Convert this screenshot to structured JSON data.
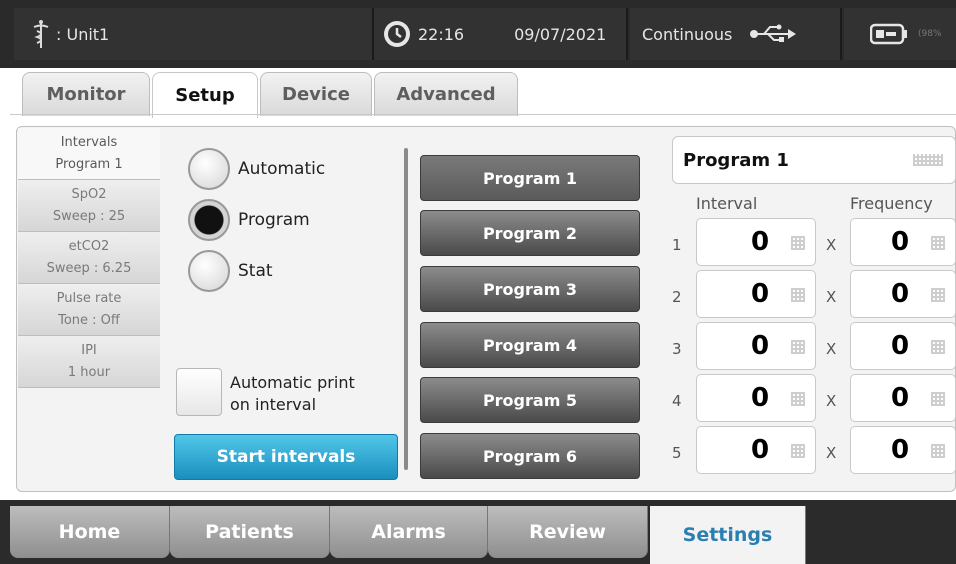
{
  "status_bar": {
    "unit": ": Unit1",
    "time": "22:16",
    "date": "09/07/2021",
    "mode": "Continuous",
    "battery_percent": "(98%"
  },
  "tabs": [
    {
      "label": "Monitor",
      "active": false
    },
    {
      "label": "Setup",
      "active": true
    },
    {
      "label": "Device",
      "active": false
    },
    {
      "label": "Advanced",
      "active": false
    }
  ],
  "side_list": [
    {
      "line1": "Intervals",
      "line2": "Program 1",
      "selected": true
    },
    {
      "line1": "SpO2",
      "line2": "Sweep : 25",
      "selected": false
    },
    {
      "line1": "etCO2",
      "line2": "Sweep : 6.25",
      "selected": false
    },
    {
      "line1": "Pulse rate",
      "line2": "Tone : Off",
      "selected": false
    },
    {
      "line1": "IPI",
      "line2": "1 hour",
      "selected": false
    }
  ],
  "interval_modes": {
    "options": [
      "Automatic",
      "Program",
      "Stat"
    ],
    "selected": "Program"
  },
  "auto_print": {
    "label_line1": "Automatic print",
    "label_line2": "on interval",
    "checked": false
  },
  "start_button": "Start intervals",
  "programs": [
    "Program 1",
    "Program 2",
    "Program 3",
    "Program 4",
    "Program 5",
    "Program 6"
  ],
  "selected_program": "Program 1",
  "program_name": "Program 1",
  "headers": {
    "interval": "Interval",
    "frequency": "Frequency"
  },
  "rows": [
    {
      "num": "1",
      "interval": "0",
      "x": "X",
      "frequency": "0"
    },
    {
      "num": "2",
      "interval": "0",
      "x": "X",
      "frequency": "0"
    },
    {
      "num": "3",
      "interval": "0",
      "x": "X",
      "frequency": "0"
    },
    {
      "num": "4",
      "interval": "0",
      "x": "X",
      "frequency": "0"
    },
    {
      "num": "5",
      "interval": "0",
      "x": "X",
      "frequency": "0"
    }
  ],
  "bottom_nav": [
    {
      "label": "Home",
      "active": false
    },
    {
      "label": "Patients",
      "active": false
    },
    {
      "label": "Alarms",
      "active": false
    },
    {
      "label": "Review",
      "active": false
    },
    {
      "label": "Settings",
      "active": true
    }
  ],
  "colors": {
    "accent": "#1a8fbf",
    "active_nav_text": "#2a7fb0",
    "status_bar": "#2a2a2a"
  }
}
